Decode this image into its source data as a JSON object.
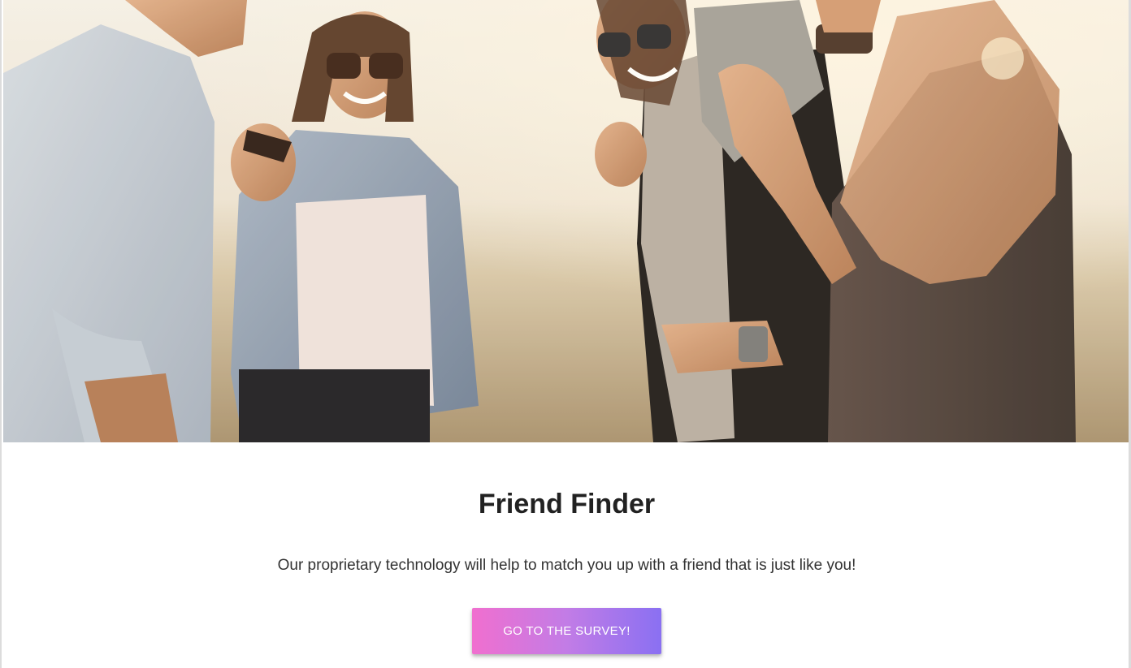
{
  "hero": {
    "image_name": "friends-laughing-photo",
    "colors": {
      "sky": "#f4efe8",
      "haze": "#d9c9ad",
      "ground": "#b59a76",
      "warm_light": "#f7d89a"
    }
  },
  "main": {
    "title": "Friend Finder",
    "description": "Our proprietary technology will help to match you up with a friend that is just like you!",
    "cta_label": "Go to the Survey!"
  },
  "theme": {
    "gradient_start": "#f06fcf",
    "gradient_end": "#8a70f2",
    "title_color": "#212121",
    "text_color": "#333333"
  }
}
